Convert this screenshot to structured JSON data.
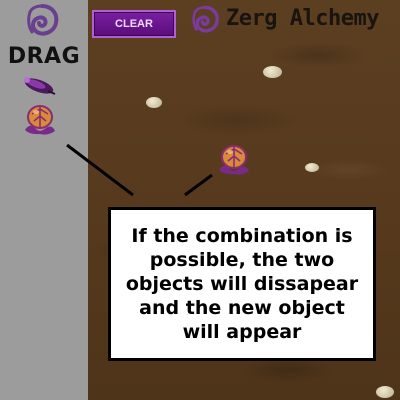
{
  "header": {
    "clear_label": "CLEAR",
    "title": "Zerg Alchemy",
    "logo_icon": "zerg-swirl-icon"
  },
  "sidebar": {
    "drag_label": "DRAG",
    "logo_icon": "zerg-swirl-icon",
    "items": [
      {
        "icon": "zerg-larva-icon"
      },
      {
        "icon": "zerg-egg-icon"
      }
    ]
  },
  "board": {
    "placed_items": [
      {
        "icon": "zerg-egg-icon"
      }
    ]
  },
  "instruction": {
    "text": "If the combination is possible, the two objects will dissapear and the new object will appear"
  },
  "colors": {
    "accent": "#7b1fa2",
    "panel": "#9c9c9c",
    "dirt": "#573a1e"
  }
}
